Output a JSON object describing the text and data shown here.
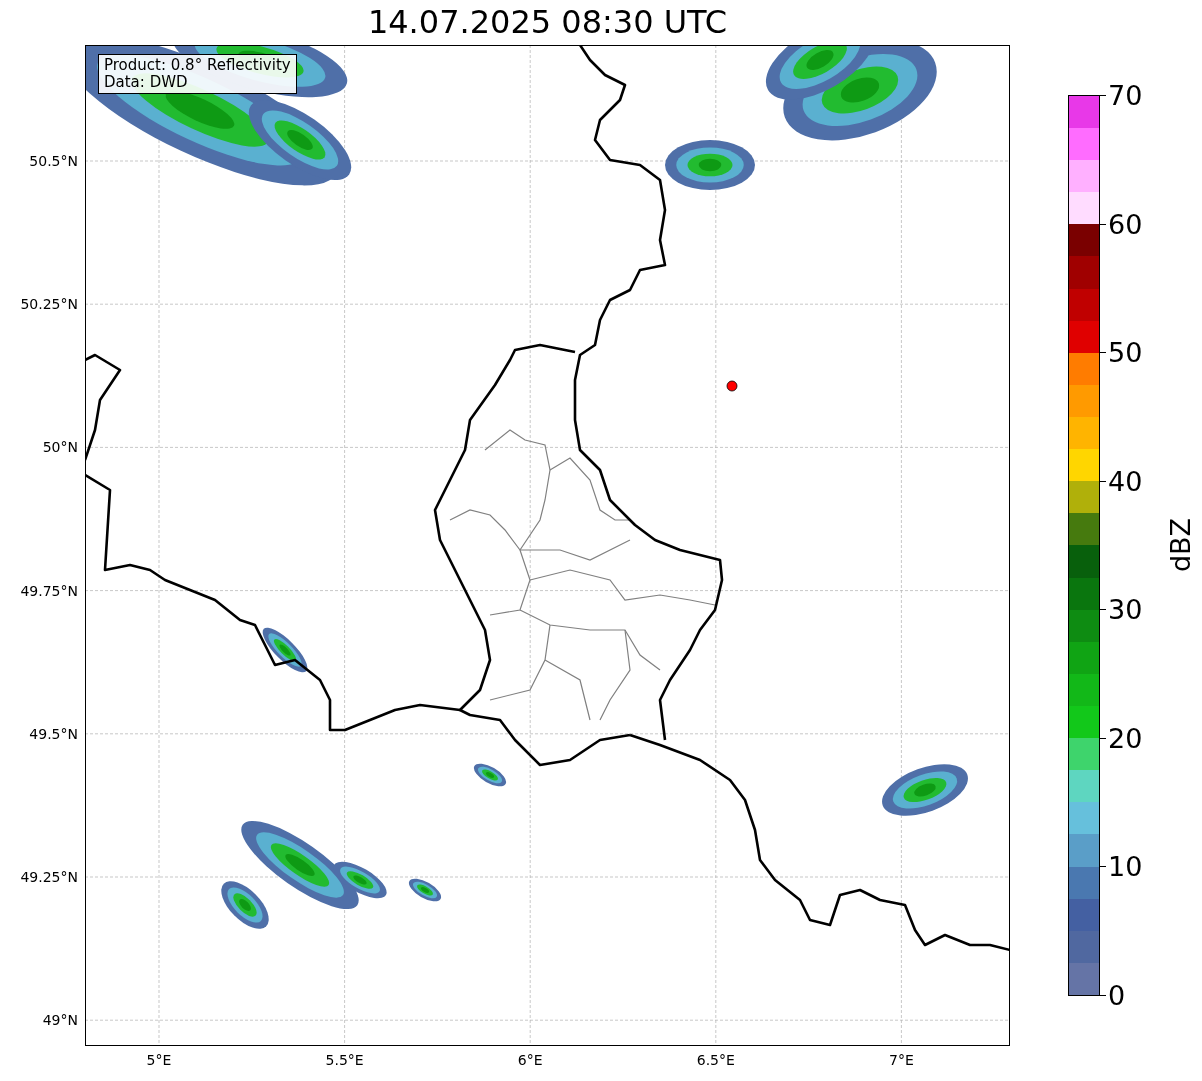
{
  "title": "14.07.2025 08:30 UTC",
  "map": {
    "info_lines": [
      "Product: 0.8° Reflectivity",
      "Data: DWD"
    ],
    "lat_labels": [
      "50.5°N",
      "50.25°N",
      "50°N",
      "49.75°N",
      "49.5°N",
      "49.25°N",
      "49°N"
    ],
    "lon_labels": [
      "5°E",
      "5.5°E",
      "6°E",
      "6.5°E",
      "7°E"
    ]
  },
  "colorbar": {
    "label": "dBZ",
    "ticks": [
      "70",
      "60",
      "50",
      "40",
      "30",
      "20",
      "10",
      "0"
    ],
    "bands": [
      {
        "color": "#6574a6"
      },
      {
        "color": "#5068a0"
      },
      {
        "color": "#4460a2"
      },
      {
        "color": "#4a78b0"
      },
      {
        "color": "#5a9ec8"
      },
      {
        "color": "#66c0dc"
      },
      {
        "color": "#5ed6c0"
      },
      {
        "color": "#3ed46c"
      },
      {
        "color": "#12c81a"
      },
      {
        "color": "#12b818"
      },
      {
        "color": "#10a414"
      },
      {
        "color": "#0e8c12"
      },
      {
        "color": "#0a760e"
      },
      {
        "color": "#08600c"
      },
      {
        "color": "#467a0e"
      },
      {
        "color": "#b0b00a"
      },
      {
        "color": "#ffd600"
      },
      {
        "color": "#ffb400"
      },
      {
        "color": "#ff9a00"
      },
      {
        "color": "#ff7c00"
      },
      {
        "color": "#e00000"
      },
      {
        "color": "#c00000"
      },
      {
        "color": "#a00000"
      },
      {
        "color": "#7a0000"
      },
      {
        "color": "#ffdcff"
      },
      {
        "color": "#ffb0ff"
      },
      {
        "color": "#ff6cff"
      },
      {
        "color": "#e838e8"
      }
    ]
  }
}
